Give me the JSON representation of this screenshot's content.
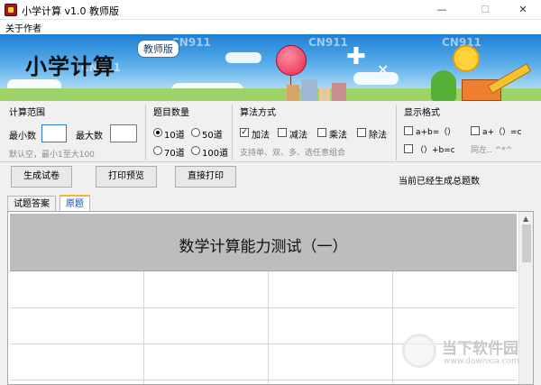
{
  "window": {
    "title": "小学计算 v1.0 教师版",
    "controls": {
      "minimize": "—",
      "maximize": "☐",
      "close": "✕"
    }
  },
  "menu": {
    "items": [
      {
        "label": "关于作者"
      }
    ]
  },
  "banner": {
    "title": "小学计算",
    "badge": "教师版",
    "watermarks": [
      "CN911",
      "CN911",
      "CN911",
      "CN911"
    ]
  },
  "range": {
    "title": "计算范围",
    "min_label": "最小数",
    "max_label": "最大数",
    "min_value": "",
    "max_value": "",
    "hint": "默认空，最小1至大100"
  },
  "count": {
    "title": "题目数量",
    "options": [
      {
        "label": "10道",
        "selected": true
      },
      {
        "label": "50道",
        "selected": false
      },
      {
        "label": "70道",
        "selected": false
      },
      {
        "label": "100道",
        "selected": false
      }
    ]
  },
  "ops": {
    "title": "算法方式",
    "options": [
      {
        "label": "加法",
        "checked": true
      },
      {
        "label": "减法",
        "checked": false
      },
      {
        "label": "乘法",
        "checked": false
      },
      {
        "label": "除法",
        "checked": false
      }
    ],
    "hint": "支持单、双、多、选任意组合"
  },
  "format": {
    "title": "显示格式",
    "options": [
      {
        "label": "a+b=（）",
        "checked": false
      },
      {
        "label": "a+（）=c",
        "checked": false
      },
      {
        "label": "（）+b=c",
        "checked": false
      }
    ],
    "hint": "同左..  ^*^"
  },
  "toolbar": {
    "generate": "生成试卷",
    "preview": "打印预览",
    "print": "直接打印",
    "status": "当前已经生成总题数"
  },
  "tabs": [
    {
      "label": "试题答案",
      "active": false
    },
    {
      "label": "原题",
      "active": true
    }
  ],
  "sheet": {
    "title": "数学计算能力测试（一）"
  },
  "watermark": {
    "name": "当下软件园",
    "url": "www.downxia.com"
  }
}
